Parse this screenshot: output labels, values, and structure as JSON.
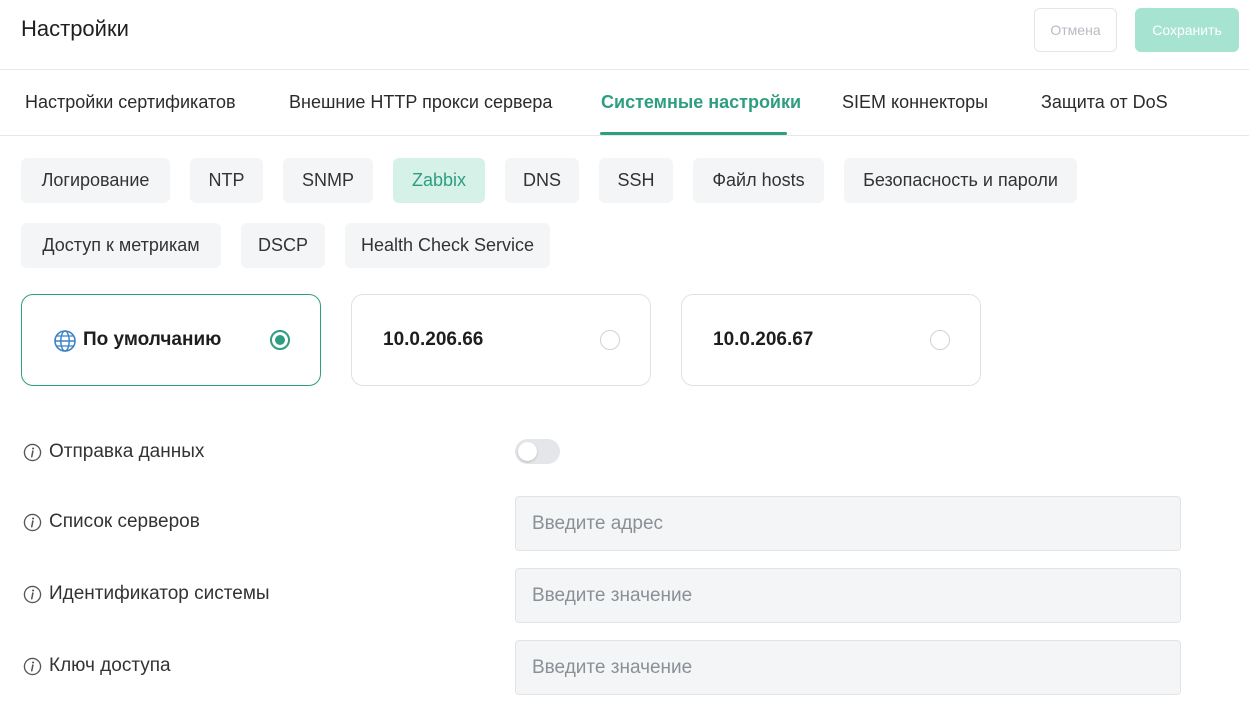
{
  "header": {
    "title": "Настройки",
    "cancel_label": "Отмена",
    "save_label": "Сохранить"
  },
  "tabs": [
    {
      "label": "Настройки сертификатов",
      "active": false
    },
    {
      "label": "Внешние HTTP прокси сервера",
      "active": false
    },
    {
      "label": "Системные настройки",
      "active": true
    },
    {
      "label": "SIEM коннекторы",
      "active": false
    },
    {
      "label": "Защита от DoS",
      "active": false
    }
  ],
  "subtabs": [
    {
      "label": "Логирование",
      "active": false
    },
    {
      "label": "NTP",
      "active": false
    },
    {
      "label": "SNMP",
      "active": false
    },
    {
      "label": "Zabbix",
      "active": true
    },
    {
      "label": "DNS",
      "active": false
    },
    {
      "label": "SSH",
      "active": false
    },
    {
      "label": "Файл hosts",
      "active": false
    },
    {
      "label": "Безопасность и пароли",
      "active": false
    },
    {
      "label": "Доступ к метрикам",
      "active": false
    },
    {
      "label": "DSCP",
      "active": false
    },
    {
      "label": "Health Check Service",
      "active": false
    }
  ],
  "nodes": [
    {
      "label": "По умолчанию",
      "icon": "globe-icon",
      "selected": true
    },
    {
      "label": "10.0.206.66",
      "selected": false
    },
    {
      "label": "10.0.206.67",
      "selected": false
    }
  ],
  "form": {
    "send_data": {
      "label": "Отправка данных",
      "enabled": false
    },
    "servers": {
      "label": "Список серверов",
      "value": "",
      "placeholder": "Введите адрес"
    },
    "system_id": {
      "label": "Идентификатор системы",
      "value": "",
      "placeholder": "Введите значение"
    },
    "access_key": {
      "label": "Ключ доступа",
      "value": "",
      "placeholder": "Введите значение"
    }
  },
  "colors": {
    "accent": "#2e9e80",
    "accent_light": "#d6f1e8",
    "save_disabled": "#a6e3d1"
  }
}
